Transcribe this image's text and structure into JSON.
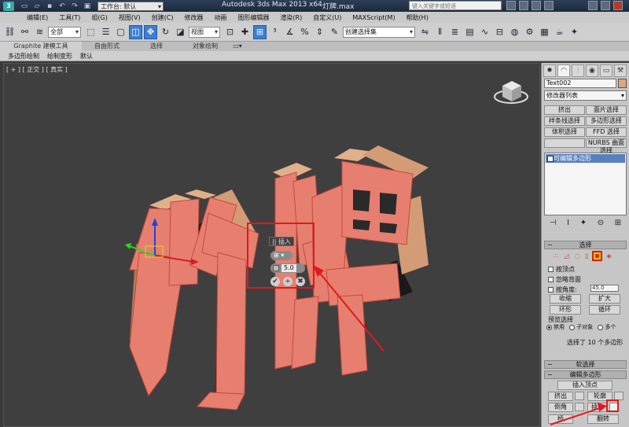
{
  "titlebar": {
    "workspace": "工作台: 默认",
    "app_title": "Autodesk 3ds Max  2013 x64",
    "file_name": "灯牌.max",
    "search_placeholder": "键入关键字或短语"
  },
  "menu": [
    "编辑(E)",
    "工具(T)",
    "组(G)",
    "视图(V)",
    "创建(C)",
    "修改器",
    "动画",
    "图形编辑器",
    "渲染(R)",
    "自定义(U)",
    "MAXScript(M)",
    "帮助(H)"
  ],
  "toolbar": {
    "selection_filter": "全部",
    "ref_coord": "视图",
    "named_selection": "创建选择集"
  },
  "ribbon": {
    "tabs": [
      "Graphite 建模工具",
      "自由形式",
      "选择",
      "对象绘制"
    ],
    "tools": [
      "多边形绘制",
      "绘制变形",
      "默认"
    ]
  },
  "viewport": {
    "label": "[ + ] [ 正交 ] [ 真实 ]",
    "text_3d": "灯牌"
  },
  "caddy": {
    "title": "|| 插入",
    "type_value": "⊞ ▾",
    "amount": "5.0",
    "ok": "✔",
    "apply": "+",
    "cancel": "✖"
  },
  "command_panel": {
    "object_name": "Text002",
    "object_color": "#e0a67c",
    "modifier_list": "修改器列表",
    "mod_buttons": [
      "挤出",
      "面片选择",
      "样条线选择",
      "多边形选择",
      "体积选择",
      "FFD 选择",
      "",
      "NURBS 曲面选择"
    ],
    "stack_item": "可编辑多边形",
    "selection_rollout": "选择",
    "by_vertex": "按顶点",
    "ignore_backfacing": "忽略背面",
    "by_angle": "按角度:",
    "angle_value": "45.0",
    "shrink": "收缩",
    "grow": "扩大",
    "ring": "环形",
    "loop": "循环",
    "preview_selection": "预览选择",
    "preview_options": [
      "禁用",
      "子对象",
      "多个"
    ],
    "selection_status": "选择了 10 个多边形",
    "soft_selection": "软选择",
    "edit_polygons": "编辑多边形",
    "insert_vertex": "插入顶点",
    "extrude": "挤出",
    "outline": "轮廓",
    "bevel": "倒角",
    "inset": "插入",
    "bridge": "桥",
    "flip": "翻转"
  },
  "colors": {
    "highlight": "#e2181b",
    "front_face": "#e77f70",
    "side_face": "#e0b08a"
  }
}
